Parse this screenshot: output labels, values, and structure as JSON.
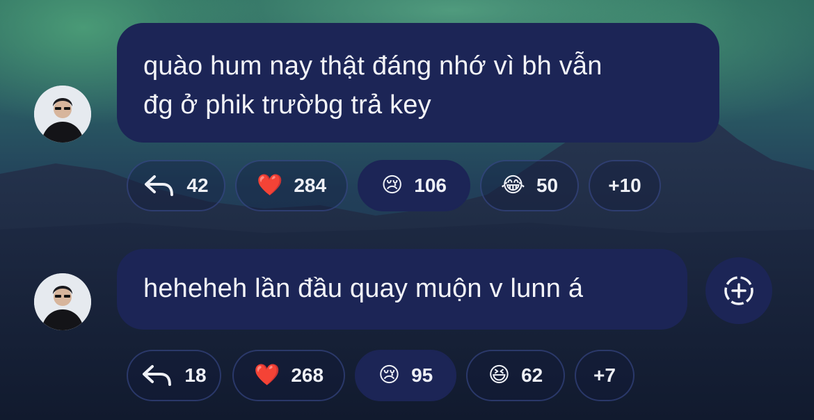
{
  "messages": [
    {
      "text_lines": [
        "quào hum nay thật đáng nhớ vì bh vẫn",
        "đg ở phik trườbg trả key"
      ],
      "reactions": [
        {
          "icon": "reply-icon",
          "count": "42"
        },
        {
          "icon": "heart-emoji",
          "glyph": "❤️",
          "count": "284"
        },
        {
          "icon": "crying-face-emoji",
          "glyph": "😢",
          "count": "106",
          "active": true
        },
        {
          "icon": "tears-of-joy-emoji",
          "glyph": "😂",
          "count": "50"
        },
        {
          "label": "+10"
        }
      ]
    },
    {
      "text_lines": [
        "heheheh lần đầu quay muộn v lunn á"
      ],
      "reactions": [
        {
          "icon": "reply-icon",
          "count": "18"
        },
        {
          "icon": "heart-emoji",
          "glyph": "❤️",
          "count": "268"
        },
        {
          "icon": "crying-face-emoji",
          "glyph": "😢",
          "count": "95",
          "active": true
        },
        {
          "icon": "grinning-squinting-emoji",
          "glyph": "😆",
          "count": "62"
        },
        {
          "label": "+7"
        }
      ]
    }
  ],
  "colors": {
    "bubble": "#1c2556",
    "text": "#f3f4f8"
  }
}
